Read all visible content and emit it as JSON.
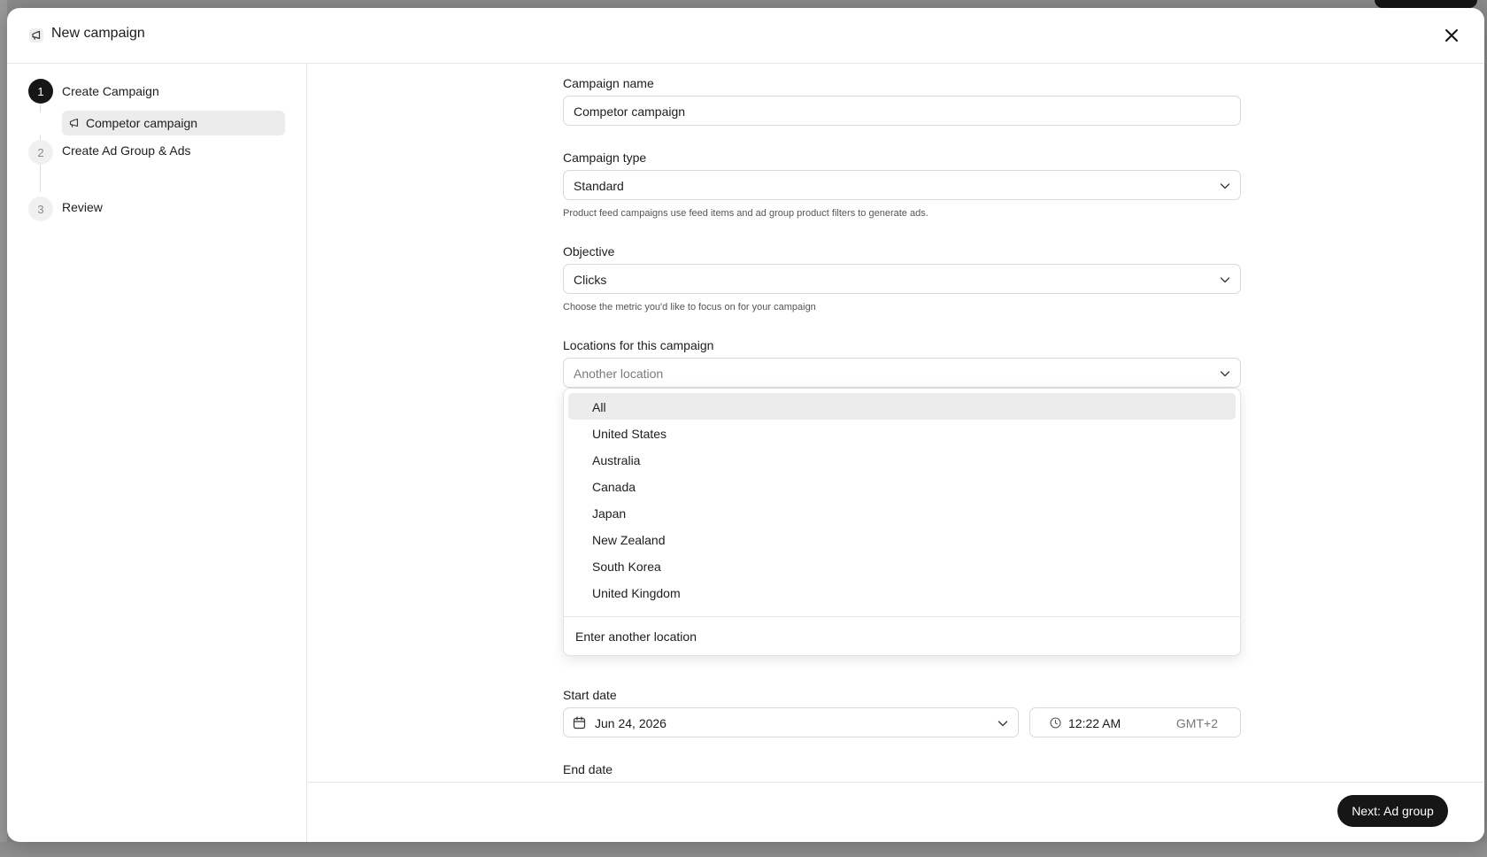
{
  "modal": {
    "title": "New campaign",
    "icons": {
      "header": "megaphone-icon",
      "close": "close-icon"
    }
  },
  "steps": [
    {
      "number": "1",
      "label": "Create Campaign",
      "status": "active",
      "sub_item": "Competor campaign"
    },
    {
      "number": "2",
      "label": "Create Ad Group & Ads",
      "status": "pending"
    },
    {
      "number": "3",
      "label": "Review",
      "status": "pending"
    }
  ],
  "form": {
    "campaign_name": {
      "label": "Campaign name",
      "value": "Competor campaign"
    },
    "campaign_type": {
      "label": "Campaign type",
      "value": "Standard",
      "hint": "Product feed campaigns use feed items and ad group product filters to generate ads."
    },
    "objective": {
      "label": "Objective",
      "value": "Clicks",
      "hint": "Choose the metric you'd like to focus on for your campaign"
    },
    "locations": {
      "label": "Locations for this campaign",
      "placeholder": "Another location",
      "options": [
        "All",
        "United States",
        "Australia",
        "Canada",
        "Japan",
        "New Zealand",
        "South Korea",
        "United Kingdom"
      ],
      "highlighted": "All",
      "footer": "Enter another location"
    },
    "start_date": {
      "label": "Start date",
      "date": "Jun 24, 2026",
      "time": "12:22 AM",
      "timezone": "GMT+2"
    },
    "end_date": {
      "label": "End date"
    }
  },
  "footer": {
    "next_label": "Next: Ad group"
  },
  "colors": {
    "primary": "#161616",
    "highlight": "#ececec",
    "border": "#d9d9d9"
  }
}
